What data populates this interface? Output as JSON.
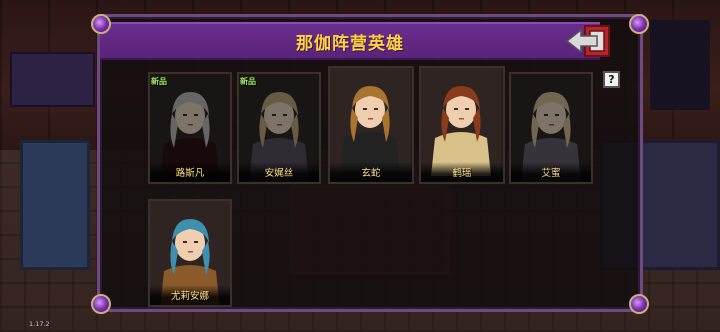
{
  "window": {
    "title": "那伽阵营英雄"
  },
  "badges": {
    "new": "新品"
  },
  "help": {
    "label": "?"
  },
  "heroes": [
    {
      "name": "路斯凡",
      "is_new": true,
      "dim": true,
      "hair": "#b9b9b9",
      "outfit": "#3a0d12"
    },
    {
      "name": "安娓丝",
      "is_new": true,
      "dim": true,
      "hair": "#c9a65a",
      "outfit": "#5b4a64"
    },
    {
      "name": "玄蛇",
      "is_new": false,
      "dim": false,
      "hair": "#a8742f",
      "outfit": "#222222"
    },
    {
      "name": "鹤瑶",
      "is_new": false,
      "dim": false,
      "hair": "#8a3b1d",
      "outfit": "#d8c28a"
    },
    {
      "name": "艾蜜",
      "is_new": false,
      "dim": true,
      "hair": "#d8b878",
      "outfit": "#6b5a70"
    },
    {
      "name": "尤莉安娜",
      "is_new": false,
      "dim": false,
      "hair": "#3f8fb0",
      "outfit": "#8a5a2a"
    }
  ],
  "version": "1.17.2",
  "colors": {
    "title_bar": "#6b2d8f",
    "title_text": "#ffd23c",
    "panel_border": "#6e4a7e",
    "name_text": "#ffe08a",
    "new_badge": "#9fe860"
  }
}
